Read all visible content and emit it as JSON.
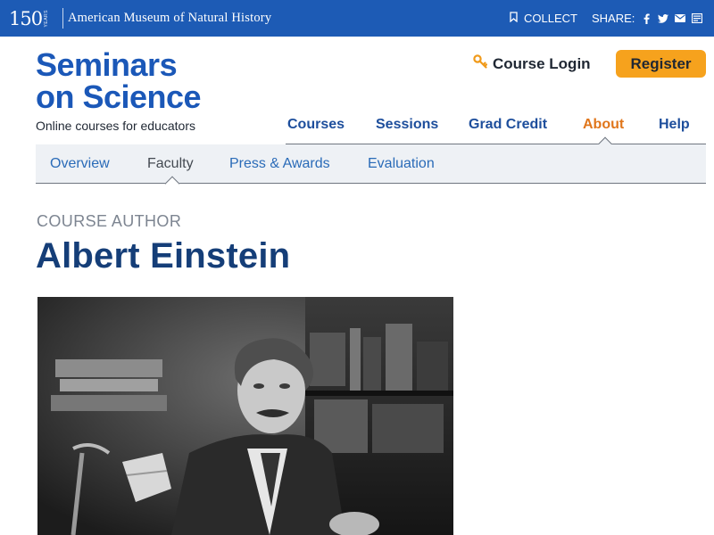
{
  "topbar": {
    "logo_number": "150",
    "logo_years": "YEARS",
    "museum_name": "American Museum of Natural History",
    "collect_label": "COLLECT",
    "share_label": "SHARE:",
    "share_icons": [
      "facebook-icon",
      "twitter-icon",
      "email-icon",
      "print-icon"
    ],
    "background_color": "#1d5bb5"
  },
  "brand": {
    "title_line1": "Seminars",
    "title_line2": "on Science",
    "tagline": "Online courses for educators",
    "color": "#1b58b8"
  },
  "header": {
    "login_label": "Course Login",
    "register_label": "Register",
    "register_color": "#f6a21d"
  },
  "main_nav": {
    "items": [
      {
        "label": "Courses"
      },
      {
        "label": "Sessions"
      },
      {
        "label": "Grad Credit"
      },
      {
        "label": "About",
        "active": true
      },
      {
        "label": "Help"
      }
    ],
    "active_color": "#e0761b"
  },
  "sub_nav": {
    "items": [
      {
        "label": "Overview"
      },
      {
        "label": "Faculty",
        "active": true
      },
      {
        "label": "Press & Awards"
      },
      {
        "label": "Evaluation"
      }
    ]
  },
  "content": {
    "kicker": "COURSE AUTHOR",
    "name": "Albert Einstein",
    "photo_icon": "portrait-photo"
  }
}
